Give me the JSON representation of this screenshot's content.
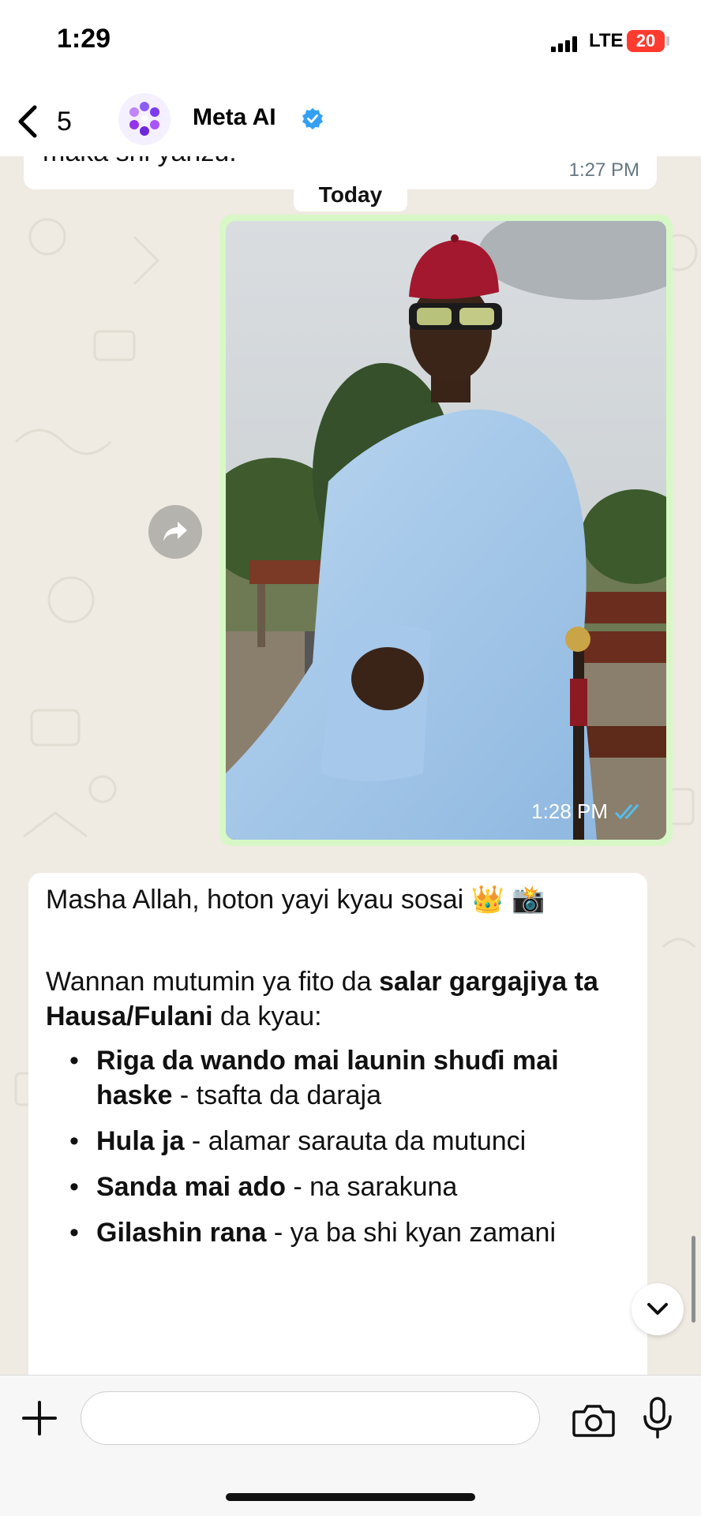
{
  "status_bar": {
    "time": "1:29",
    "network": "LTE",
    "battery": "20"
  },
  "header": {
    "back_count": "5",
    "contact_name": "Meta AI",
    "verified": "verified-badge-icon"
  },
  "chat": {
    "previous_message_text": "maka shi yanzu.",
    "previous_message_time": "1:27 PM",
    "date_separator": "Today",
    "photo_message_time": "1:28 PM",
    "reply": {
      "line1": "Masha Allah, hoton yayi kyau sosai 👑 📸",
      "para2_pre": "Wannan mutumin ya fito da ",
      "para2_bold": "salar gargajiya ta Hausa/Fulani",
      "para2_post": " da kyau:",
      "bullets": [
        {
          "bold": "Riga da wando mai launin shuɗi mai haske",
          "rest": " - tsafta da daraja"
        },
        {
          "bold": "Hula ja",
          "rest": " - alamar sarauta da mutunci"
        },
        {
          "bold": "Sanda mai ado",
          "rest": " - na sarakuna"
        },
        {
          "bold": "Gilashin rana",
          "rest": " - ya ba shi kyan zamani"
        }
      ]
    }
  },
  "composer": {
    "placeholder": ""
  },
  "colors": {
    "outgoing_bubble": "#d7f8c6",
    "incoming_bubble": "#ffffff",
    "wallpaper": "#efeae2",
    "accent_blue": "#34a0f5"
  }
}
